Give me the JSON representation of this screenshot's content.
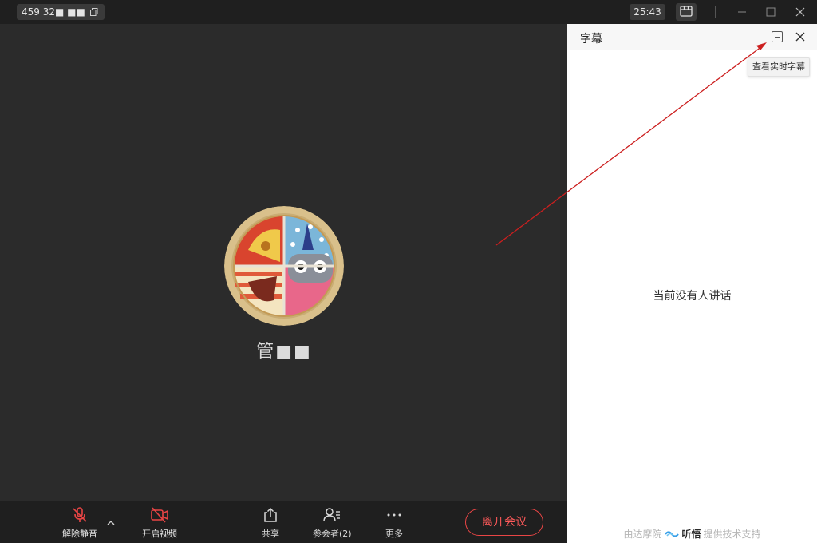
{
  "titlebar": {
    "meeting_id": "459 32■ ■■",
    "timer": "25:43",
    "icons": [
      "copy-icon",
      "layout-icon",
      "minimize-icon",
      "maximize-icon",
      "close-icon"
    ]
  },
  "main": {
    "participant_name": "管■■"
  },
  "toolbar": {
    "unmute_label": "解除静音",
    "video_label": "开启视频",
    "share_label": "共享",
    "participants_label": "参会者(2)",
    "more_label": "更多",
    "leave_label": "离开会议",
    "accent_red": "#e84545"
  },
  "panel": {
    "title": "字幕",
    "tooltip": "查看实时字幕",
    "empty_message": "当前没有人讲话",
    "footer_prefix": "由达摩院",
    "footer_brand": "听悟",
    "footer_suffix": "提供技术支持"
  },
  "annotation": {
    "color": "#cc1f1f"
  }
}
